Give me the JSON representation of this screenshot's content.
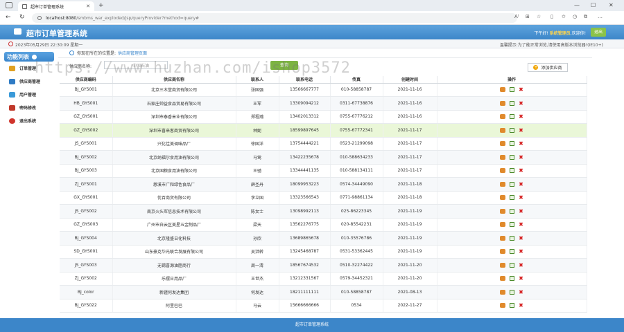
{
  "browser": {
    "tab_title": "超市订单管理系统",
    "url_host": "localhost:8080",
    "url_path": "/smbms_war_exploded/jsp/queryProvider?method=query#"
  },
  "header": {
    "title": "超市订单管理系统",
    "greeting_prefix": "下午好!",
    "user": "系统管理员",
    "greeting_suffix": ",欢迎你!",
    "logout_label": "退出"
  },
  "infobar": {
    "datetime": "2023年05月29日 22:30:09 星期一",
    "tip": "温馨提示:为了能正常浏览,请使用高版本浏览器!(IE10+)"
  },
  "sidebar": {
    "title": "功能列表",
    "items": [
      {
        "label": "订单管理",
        "color": "#e0a020"
      },
      {
        "label": "供应商管理",
        "color": "#2e7bc4"
      },
      {
        "label": "用户管理",
        "color": "#3a9ad9"
      },
      {
        "label": "密码修改",
        "color": "#c0392b"
      },
      {
        "label": "退出系统",
        "color": "#d0342c"
      }
    ]
  },
  "main": {
    "location_prefix": "你现在所在的位置是:",
    "location_crumb": "供应商管理页面",
    "search_label": "供应商名称:",
    "search_value": "中国石油",
    "search_button": "查询",
    "add_button": "添加供应商"
  },
  "table": {
    "headers": [
      "供应商编码",
      "供应商名称",
      "联系人",
      "联系电话",
      "传真",
      "创建时间",
      "操作"
    ],
    "rows": [
      [
        "BJ_GYS001",
        "北京三木堂商贸有限公司",
        "张国强",
        "13566667777",
        "010-58858787",
        "2021-11-16"
      ],
      [
        "HB_GYS001",
        "石家庄帅益食品贸易有限公司",
        "王军",
        "13309094212",
        "0311-67738876",
        "2021-11-16"
      ],
      [
        "GZ_GYS001",
        "深圳市泰香米业有限公司",
        "郑程瀚",
        "13402013312",
        "0755-67776212",
        "2021-11-16"
      ],
      [
        "GZ_GYS002",
        "深圳市喜来客商贸有限公司",
        "林妮",
        "18599897645",
        "0755-67772341",
        "2021-11-17"
      ],
      [
        "JS_GYS001",
        "兴化佳美调味品厂",
        "徐国洋",
        "13754444221",
        "0523-21299098",
        "2021-11-17"
      ],
      [
        "BJ_GYS002",
        "北京纳福尔食用油有限公司",
        "马莺",
        "13422235678",
        "010-588634233",
        "2021-11-17"
      ],
      [
        "BJ_GYS003",
        "北京国粮食用油有限公司",
        "王驰",
        "13344441135",
        "010-588134111",
        "2021-11-17"
      ],
      [
        "ZJ_GYS001",
        "慈溪市广和绿色食品厂",
        "薛圣丹",
        "18099953223",
        "0574-34449090",
        "2021-11-18"
      ],
      [
        "GX_GYS001",
        "优百商贸有限公司",
        "李立国",
        "13323566543",
        "0771-98861134",
        "2021-11-18"
      ],
      [
        "JS_GYS002",
        "南京火头军信息技术有限公司",
        "陈女士",
        "13098992113",
        "025-86223345",
        "2021-11-19"
      ],
      [
        "GZ_GYS003",
        "广州市白云区美星五金制品厂",
        "梁天",
        "13562276775",
        "020-85542231",
        "2021-11-19"
      ],
      [
        "BJ_GYS004",
        "北京隆盛日化科技",
        "孙欣",
        "13689865678",
        "010-35576786",
        "2021-11-19"
      ],
      [
        "SD_GYS001",
        "山东豪克华光联合发展有限公司",
        "吴洪转",
        "13245468787",
        "0531-53362445",
        "2021-11-19"
      ],
      [
        "JS_GYS003",
        "无锡喜源油脂商行",
        "周一清",
        "18567674532",
        "0510-32274422",
        "2021-11-20"
      ],
      [
        "ZJ_GYS002",
        "乐摆日用品厂",
        "王世杰",
        "13212331567",
        "0579-34452321",
        "2021-11-20"
      ],
      [
        "BJ_color",
        "新疆何发达集团",
        "何发达",
        "18211111111",
        "010-58858787",
        "2021-08-13"
      ],
      [
        "BJ_GYS022",
        "阿里巴巴",
        "马云",
        "15666666666",
        "0534",
        "2022-11-27"
      ]
    ]
  },
  "footer": {
    "text": "超市订单管理系统"
  },
  "watermark": "https://www.huzhan.com/ishop3572"
}
